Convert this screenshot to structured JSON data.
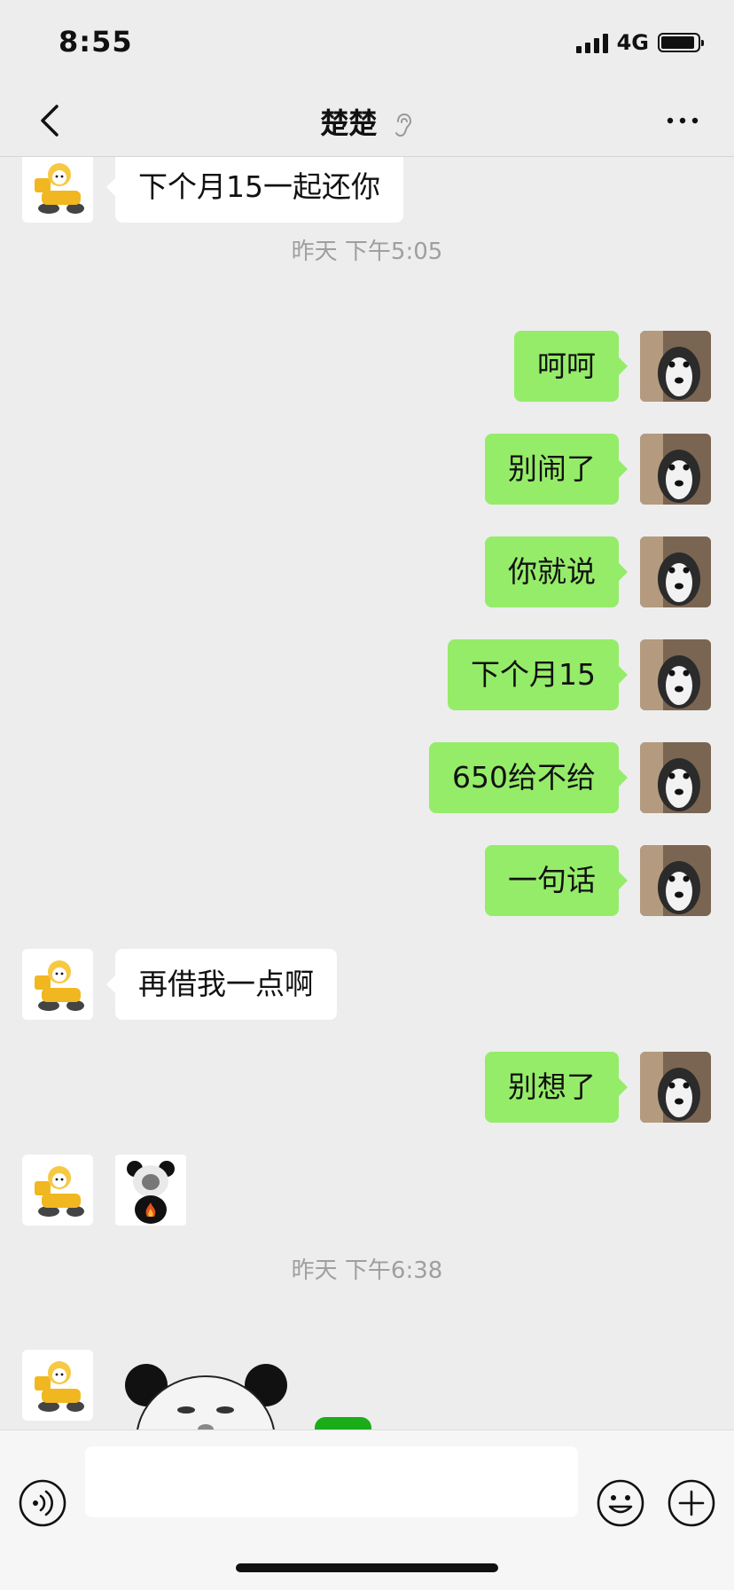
{
  "status_bar": {
    "time": "8:55",
    "network": "4G"
  },
  "nav": {
    "title": "楚楚"
  },
  "messages": [
    {
      "side": "in",
      "text": "下个月15一起还你"
    },
    {
      "type": "timestamp",
      "text": "昨天 下午5:05"
    },
    {
      "side": "out",
      "text": "呵呵"
    },
    {
      "side": "out",
      "text": "别闹了"
    },
    {
      "side": "out",
      "text": "你就说"
    },
    {
      "side": "out",
      "text": "下个月15"
    },
    {
      "side": "out",
      "text": "650给不给"
    },
    {
      "side": "out",
      "text": "一句话"
    },
    {
      "side": "in",
      "text": "再借我一点啊"
    },
    {
      "side": "out",
      "text": "别想了"
    },
    {
      "side": "in",
      "type": "sticker",
      "sticker": "panda-meme-sticker"
    },
    {
      "type": "timestamp",
      "text": "昨天 下午6:38"
    },
    {
      "side": "in",
      "type": "sticker",
      "sticker": "panda-meme-sticker-large"
    }
  ],
  "icons": {
    "back": "chevron-left-icon",
    "mute": "ear-icon",
    "more": "more-dots-icon",
    "voice": "voice-icon",
    "emoji": "emoji-icon",
    "add": "plus-icon"
  },
  "colors": {
    "outgoing_bubble": "#95ec69",
    "incoming_bubble": "#ffffff",
    "background": "#ededed"
  }
}
